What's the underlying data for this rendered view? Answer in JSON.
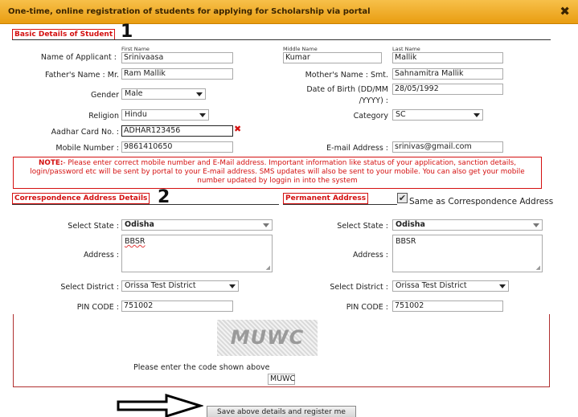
{
  "dialog": {
    "title": "One-time, online registration of students for applying for Scholarship via portal",
    "close_glyph": "✖"
  },
  "basic": {
    "heading": "Basic Details of Student",
    "marker": "1",
    "applicant_label": "Name of Applicant :",
    "first_name_caption": "First Name",
    "middle_name_caption": "Middle Name",
    "last_name_caption": "Last Name",
    "first_name": "Srinivaasa",
    "middle_name": "Kumar",
    "last_name": "Mallik",
    "father_label": "Father's Name : Mr.",
    "father_name": "Ram Mallik",
    "mother_label": "Mother's Name : Smt.",
    "mother_name": "Sahnamitra Mallik",
    "gender_label": "Gender",
    "gender": "Male",
    "dob_label_line1": "Date of Birth (DD/MM",
    "dob_label_line2": "/YYYY) :",
    "dob": "28/05/1992",
    "religion_label": "Religion",
    "religion": "Hindu",
    "category_label": "Category",
    "category": "SC",
    "aadhar_label": "Aadhar Card No. :",
    "aadhar": "ADHAR123456",
    "aadhar_error_glyph": "✖",
    "mobile_label": "Mobile Number :",
    "mobile": "9861410650",
    "email_label": "E-mail Address :",
    "email": "srinivas@gmail.com"
  },
  "note": {
    "prefix": "NOTE:",
    "text": "- Please enter correct mobile number and E-Mail address. Important information like status of your application, sanction details, login/password etc will be sent by portal to your E-mail address. SMS updates will also be sent to your mobile. You can also get your mobile number updated by loggin in into the system"
  },
  "correspondence": {
    "heading": "Correspondence Address Details",
    "marker": "2",
    "state_label": "Select State :",
    "state": "Odisha",
    "address_label": "Address :",
    "address": "BBSR",
    "district_label": "Select District :",
    "district": "Orissa Test District",
    "pin_label": "PIN CODE :",
    "pin": "751002"
  },
  "permanent": {
    "heading": "Permanent Address",
    "same_as_label": "Same as Correspondence Address",
    "same_as_checked": true,
    "check_glyph": "✔",
    "state_label": "Select State :",
    "state": "Odisha",
    "address_label": "Address :",
    "address": "BBSR",
    "district_label": "Select District :",
    "district": "Orissa Test District",
    "pin_label": "PIN CODE :",
    "pin": "751002"
  },
  "captcha": {
    "image_text": "MUWC",
    "prompt": "Please enter the code shown above",
    "value": "MUWC"
  },
  "submit_label": "Save above details and register me",
  "colors": {
    "title_bar": "#e99d11",
    "heading_red": "#d41010"
  }
}
